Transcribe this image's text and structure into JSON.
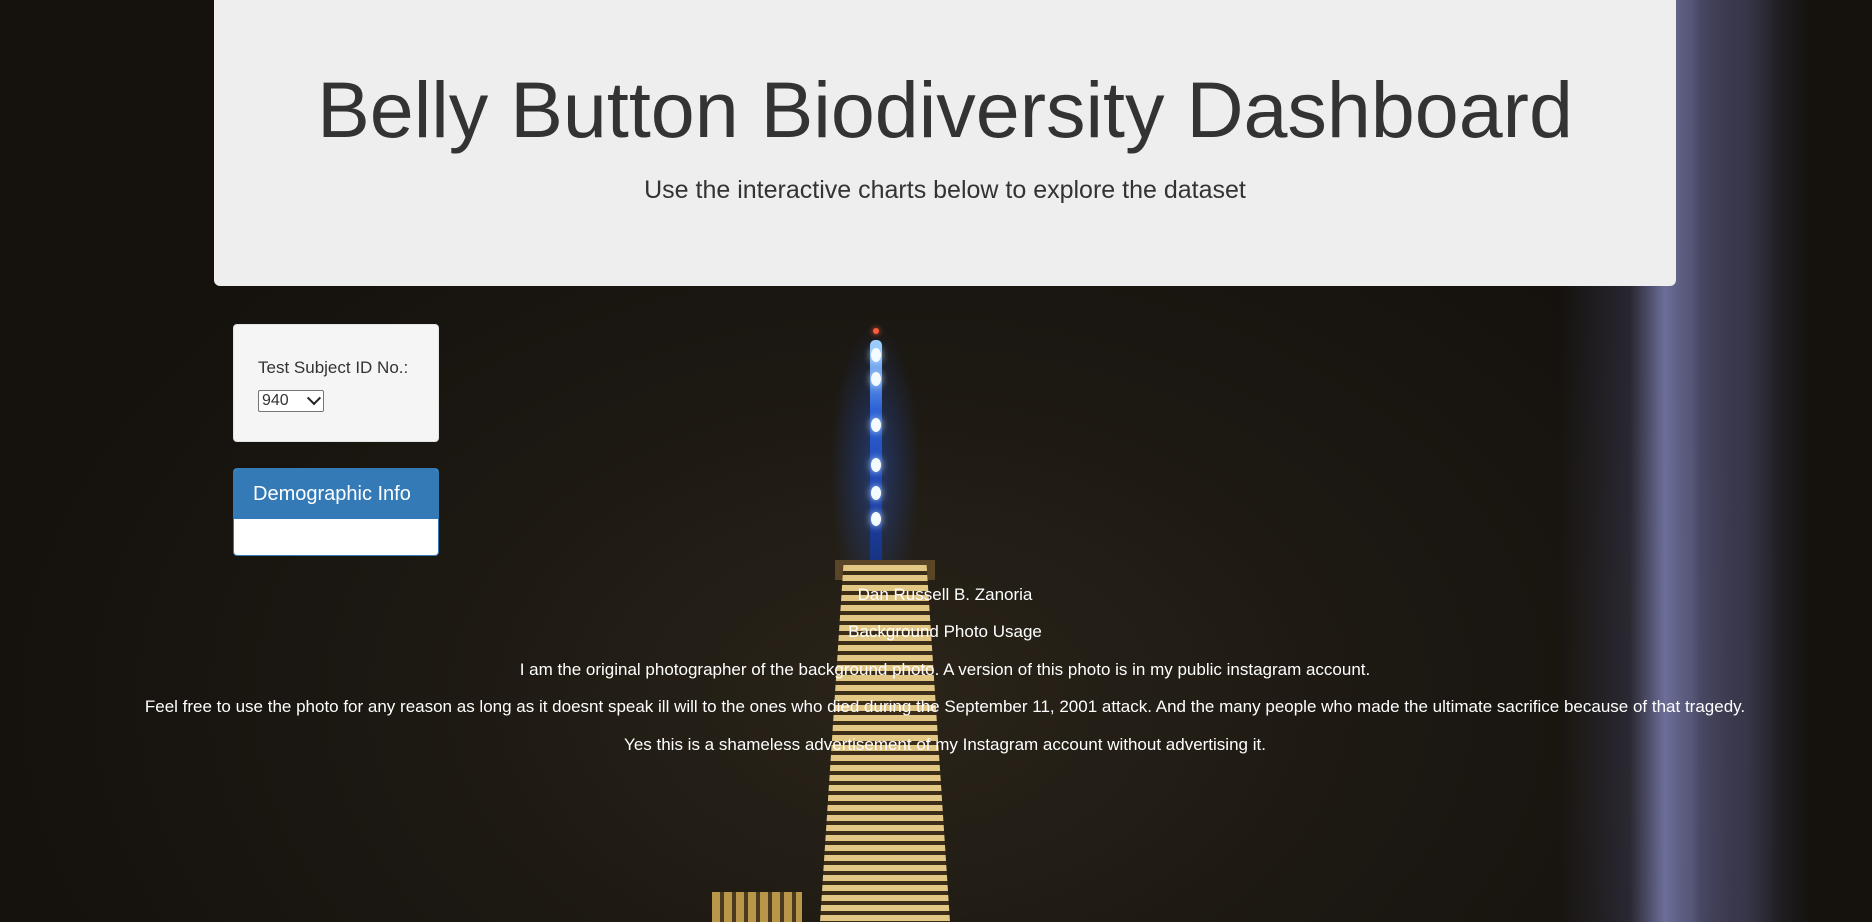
{
  "header": {
    "title": "Belly Button Biodiversity Dashboard",
    "subtitle": "Use the interactive charts below to explore the dataset"
  },
  "selector": {
    "label": "Test Subject ID No.:",
    "selected_value": "940"
  },
  "demographic_panel": {
    "title": "Demographic Info"
  },
  "footer": {
    "author": "Dan Russell B. Zanoria",
    "usage_heading": "Background Photo Usage",
    "line1": "I am the original photographer of the background photo. A version of this photo is in my public instagram account.",
    "line2": "Feel free to use the photo for any reason as long as it doesnt speak ill will to the ones who died during the September 11, 2001 attack. And the many people who made the ultimate sacrifice because of that tragedy.",
    "line3": "Yes this is a shameless advertisement of my Instagram account without advertising it."
  },
  "colors": {
    "header_bg": "#eeeeee",
    "panel_primary": "#337ab7",
    "text_dark": "#333333",
    "footer_text": "#ffffff"
  }
}
